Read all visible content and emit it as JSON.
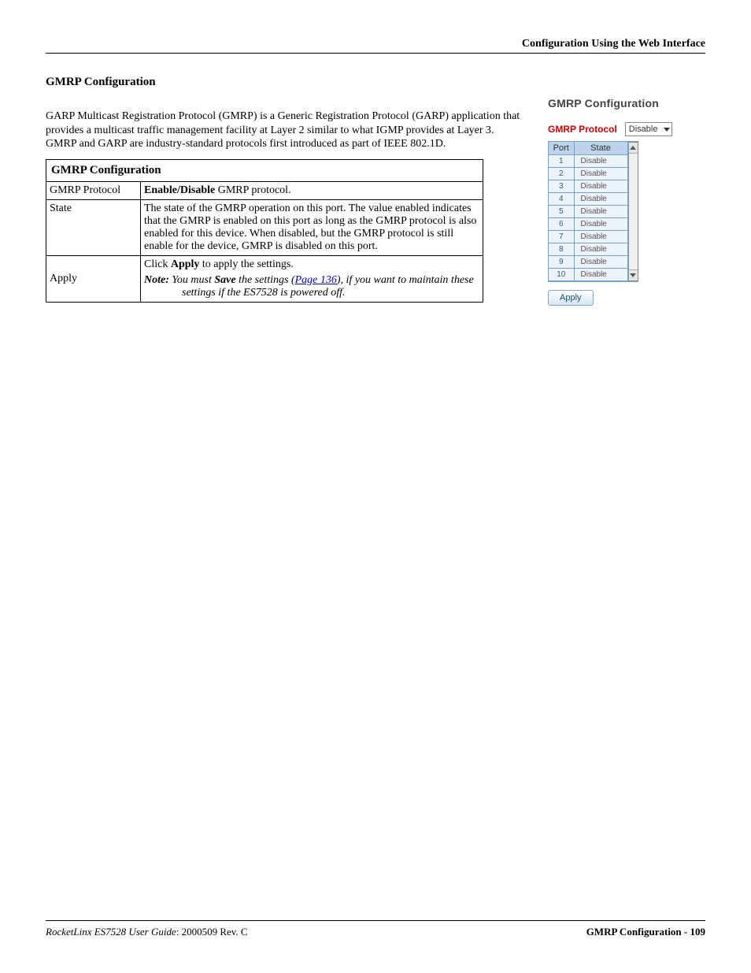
{
  "header": {
    "breadcrumb": "Configuration Using the Web Interface"
  },
  "section": {
    "title": "GMRP Configuration",
    "intro": "GARP Multicast Registration Protocol (GMRP) is a Generic Registration Protocol (GARP) application that provides a multicast traffic management facility at Layer 2 similar to what IGMP provides at Layer 3. GMRP and GARP are industry-standard protocols first introduced as part of IEEE 802.1D."
  },
  "table": {
    "caption": "GMRP Configuration",
    "rows": [
      {
        "field": "GMRP Protocol",
        "desc_prefix_bold": "Enable/Disable",
        "desc_suffix": " GMRP protocol."
      },
      {
        "field": "State",
        "desc": "The state of the GMRP operation on this port. The value enabled indicates that the GMRP is enabled on this port as long as the GMRP protocol is also enabled for this device. When disabled, but the GMRP protocol is still enable for the device, GMRP is disabled on this port."
      },
      {
        "field": "Apply",
        "click_prefix": "Click ",
        "click_bold": "Apply",
        "click_suffix": " to apply the settings.",
        "note_label": "Note:",
        "note_part1": "  You must ",
        "note_bold": "Save",
        "note_part2": " the settings (",
        "note_link": "Page 136",
        "note_part3": "), if you want to maintain these settings if the ES7528 is powered off."
      }
    ]
  },
  "widget": {
    "title": "GMRP Configuration",
    "proto_label": "GMRP Protocol",
    "proto_value": "Disable",
    "headers": {
      "port": "Port",
      "state": "State"
    },
    "ports": [
      {
        "port": "1",
        "state": "Disable"
      },
      {
        "port": "2",
        "state": "Disable"
      },
      {
        "port": "3",
        "state": "Disable"
      },
      {
        "port": "4",
        "state": "Disable"
      },
      {
        "port": "5",
        "state": "Disable"
      },
      {
        "port": "6",
        "state": "Disable"
      },
      {
        "port": "7",
        "state": "Disable"
      },
      {
        "port": "8",
        "state": "Disable"
      },
      {
        "port": "9",
        "state": "Disable"
      },
      {
        "port": "10",
        "state": "Disable"
      }
    ],
    "apply_label": "Apply"
  },
  "footer": {
    "left_product_italic": "RocketLinx ES7528  User Guide",
    "left_doc": ": 2000509 Rev. C",
    "right_bold": "GMRP Configuration - 109"
  }
}
